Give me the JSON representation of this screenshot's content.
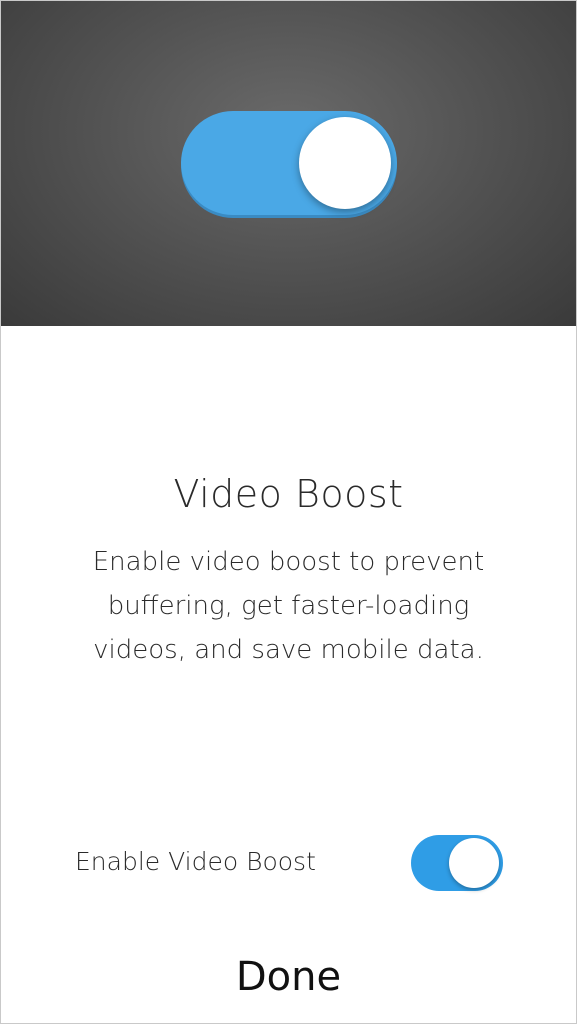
{
  "hero": {
    "illustration": "toggle-switch-on",
    "accent_color": "#4aa8e6"
  },
  "content": {
    "title": "Video Boost",
    "description": "Enable video boost to prevent buffering, get faster-loading videos, and save mobile data."
  },
  "setting": {
    "label": "Enable Video Boost",
    "enabled": true,
    "switch_color": "#2f9de6"
  },
  "actions": {
    "done_label": "Done"
  }
}
